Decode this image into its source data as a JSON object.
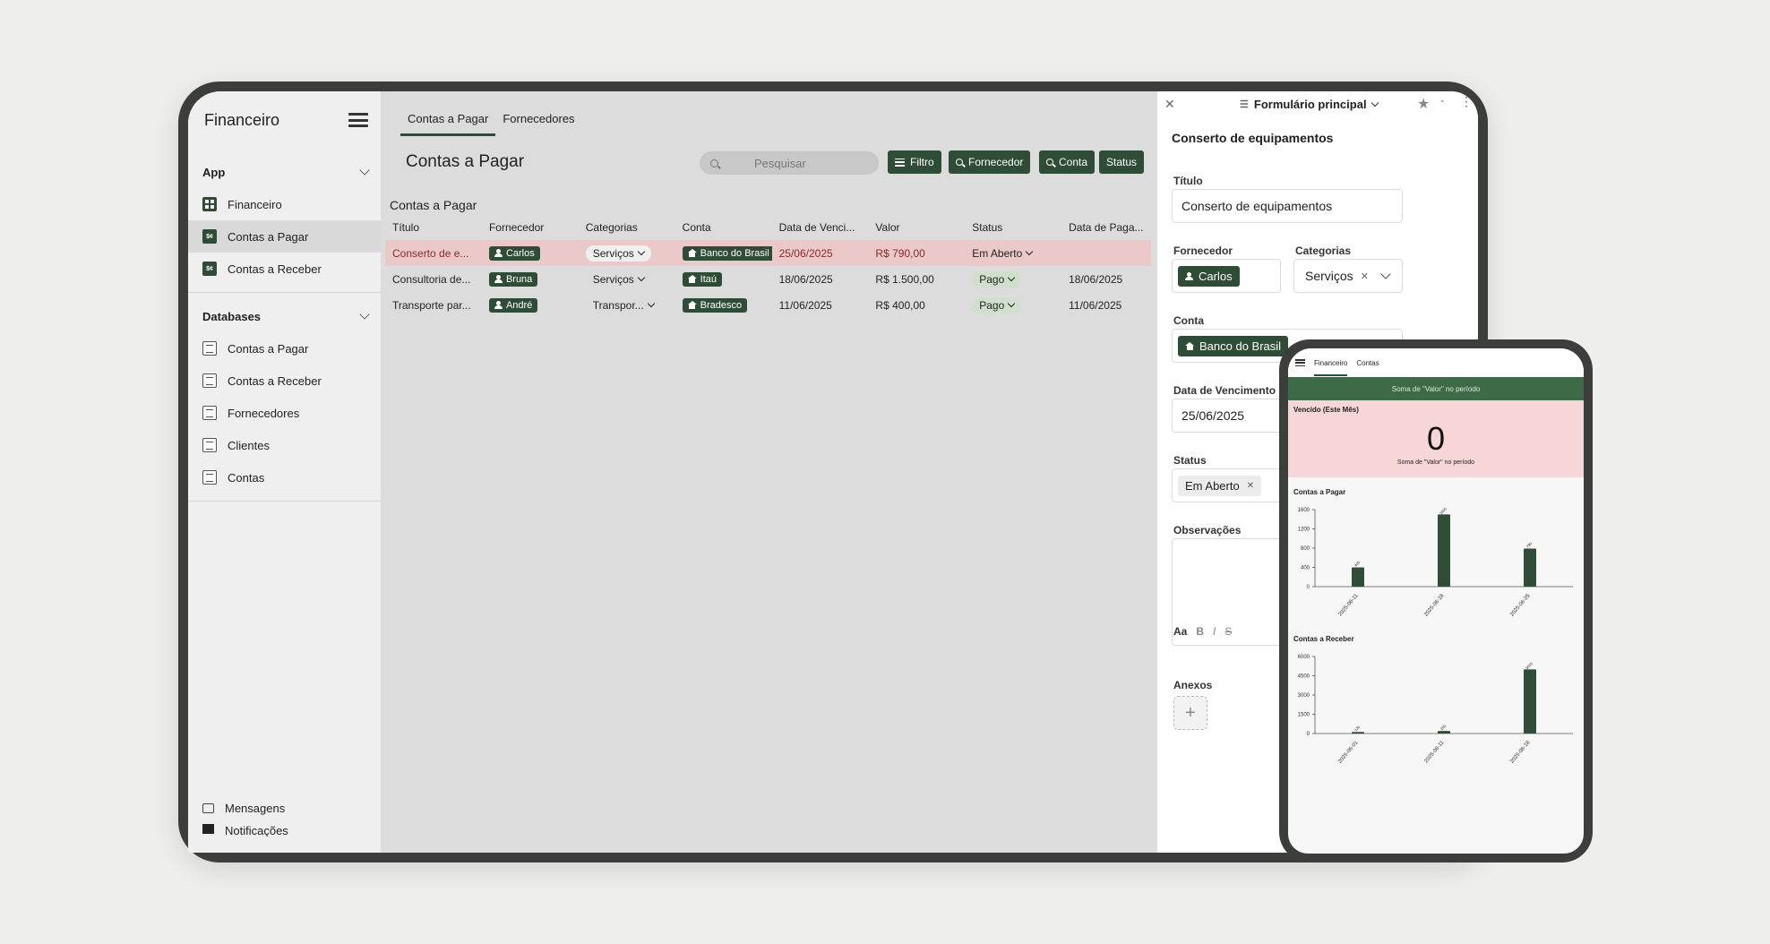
{
  "sidebar": {
    "app_title": "Financeiro",
    "sections": [
      {
        "label": "App",
        "items": [
          "Financeiro",
          "Contas a Pagar",
          "Contas a Receber"
        ]
      },
      {
        "label": "Databases",
        "items": [
          "Contas a Pagar",
          "Contas a Receber",
          "Fornecedores",
          "Clientes",
          "Contas"
        ]
      }
    ],
    "app_icon_text": "$¢",
    "bottom": [
      "Mensagens",
      "Notificações"
    ]
  },
  "tabs": [
    "Contas a Pagar",
    "Fornecedores"
  ],
  "toolbar": {
    "page_title": "Contas a Pagar",
    "search_placeholder": "Pesquisar",
    "buttons": [
      "Filtro",
      "Fornecedor",
      "Conta",
      "Status"
    ]
  },
  "table": {
    "subtitle": "Contas a Pagar",
    "columns": [
      "Título",
      "Fornecedor",
      "Categorias",
      "Conta",
      "Data de Venci...",
      "Valor",
      "Status",
      "Data de Paga..."
    ],
    "rows": [
      {
        "titulo": "Conserto de e...",
        "fornecedor": "Carlos",
        "categoria": "Serviços",
        "conta": "Banco do Brasil",
        "venc": "25/06/2025",
        "valor": "R$ 790,00",
        "status": "Em Aberto",
        "pag": ""
      },
      {
        "titulo": "Consultoria de...",
        "fornecedor": "Bruna",
        "categoria": "Serviços",
        "conta": "Itaú",
        "venc": "18/06/2025",
        "valor": "R$ 1.500,00",
        "status": "Pago",
        "pag": "18/06/2025"
      },
      {
        "titulo": "Transporte par...",
        "fornecedor": "André",
        "categoria": "Transpor...",
        "conta": "Bradesco",
        "venc": "11/06/2025",
        "valor": "R$ 400,00",
        "status": "Pago",
        "pag": "11/06/2025"
      }
    ]
  },
  "panel": {
    "form_selector": "Formulário principal",
    "record_title": "Conserto de equipamentos",
    "fields": {
      "titulo_label": "Título",
      "titulo_value": "Conserto de equipamentos",
      "fornecedor_label": "Fornecedor",
      "fornecedor_value": "Carlos",
      "categorias_label": "Categorias",
      "categorias_value": "Serviços",
      "conta_label": "Conta",
      "conta_value": "Banco do Brasil",
      "venc_label": "Data de Vencimento",
      "venc_value": "25/06/2025",
      "status_label": "Status",
      "status_value": "Em Aberto",
      "obs_label": "Observações",
      "anexos_label": "Anexos"
    },
    "rte": [
      "Aa",
      "B",
      "I",
      "S"
    ]
  },
  "phone": {
    "tabs": [
      "Financeiro",
      "Contas"
    ],
    "green_caption": "Soma de \"Valor\" no período",
    "kpi_label": "Vencido (Este Mês)",
    "kpi_value": "0",
    "kpi_caption": "Soma de \"Valor\" no período",
    "chart_titles": [
      "Contas a Pagar",
      "Contas a Receber"
    ]
  },
  "chart_data": [
    {
      "type": "bar",
      "title": "Contas a Pagar",
      "categories": [
        "2025-06-11",
        "2025-06-18",
        "2025-06-25"
      ],
      "values": [
        400,
        1500,
        790
      ],
      "yticks": [
        0,
        400,
        800,
        1200,
        1600
      ],
      "ylim": [
        0,
        1600
      ]
    },
    {
      "type": "bar",
      "title": "Contas a Receber",
      "categories": [
        "2025-06-01",
        "2025-06-11",
        "2025-06-18"
      ],
      "values": [
        120,
        200,
        5000
      ],
      "yticks": [
        0,
        1500,
        3000,
        4500,
        6000
      ],
      "ylim": [
        0,
        6000
      ]
    }
  ],
  "colors": {
    "brand": "#2f4d36",
    "highlight_row": "#ecc9c9",
    "kpi_bg": "#f6d6d6"
  }
}
